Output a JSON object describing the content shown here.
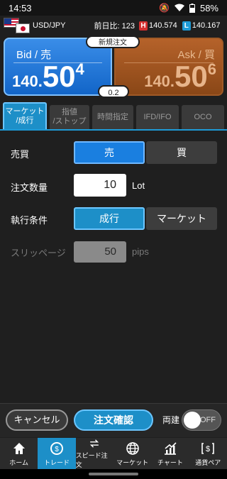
{
  "status": {
    "time": "14:53",
    "battery": "58%"
  },
  "ticker": {
    "pair": "USD/JPY",
    "ratio_label": "前日比:",
    "ratio_value": "123",
    "high_badge": "H",
    "high": "140.574",
    "low_badge": "L",
    "low": "140.167"
  },
  "quotes": {
    "new_order": "新規注文",
    "bid": {
      "label": "Bid / 売",
      "price_prefix": "140.",
      "price_main": "50",
      "price_sup": "4"
    },
    "ask": {
      "label": "Ask / 買",
      "price_prefix": "140.",
      "price_main": "50",
      "price_sup": "6"
    },
    "spread": "0.2"
  },
  "tabs": [
    {
      "label": "マーケット\n/成行"
    },
    {
      "label": "指値\n/ストップ"
    },
    {
      "label": "時間指定"
    },
    {
      "label": "IFD/IFO"
    },
    {
      "label": "OCO"
    }
  ],
  "form": {
    "side_label": "売買",
    "sell": "売",
    "buy": "買",
    "qty_label": "注文数量",
    "qty_value": "10",
    "qty_unit": "Lot",
    "exec_label": "執行条件",
    "exec_market_order": "成行",
    "exec_market": "マーケット",
    "slip_label": "スリッページ",
    "slip_value": "50",
    "slip_unit": "pips"
  },
  "bottombar": {
    "cancel": "キャンセル",
    "confirm": "注文確認",
    "ryodate": "両建",
    "toggle": "OFF"
  },
  "nav": [
    {
      "label": "ホーム",
      "icon": "home-icon"
    },
    {
      "label": "トレード",
      "icon": "trade-icon"
    },
    {
      "label": "スピード注文",
      "icon": "speed-order-icon"
    },
    {
      "label": "マーケット",
      "icon": "globe-icon"
    },
    {
      "label": "チャート",
      "icon": "chart-icon"
    },
    {
      "label": "通貨ペア",
      "icon": "currency-pair-icon"
    }
  ]
}
